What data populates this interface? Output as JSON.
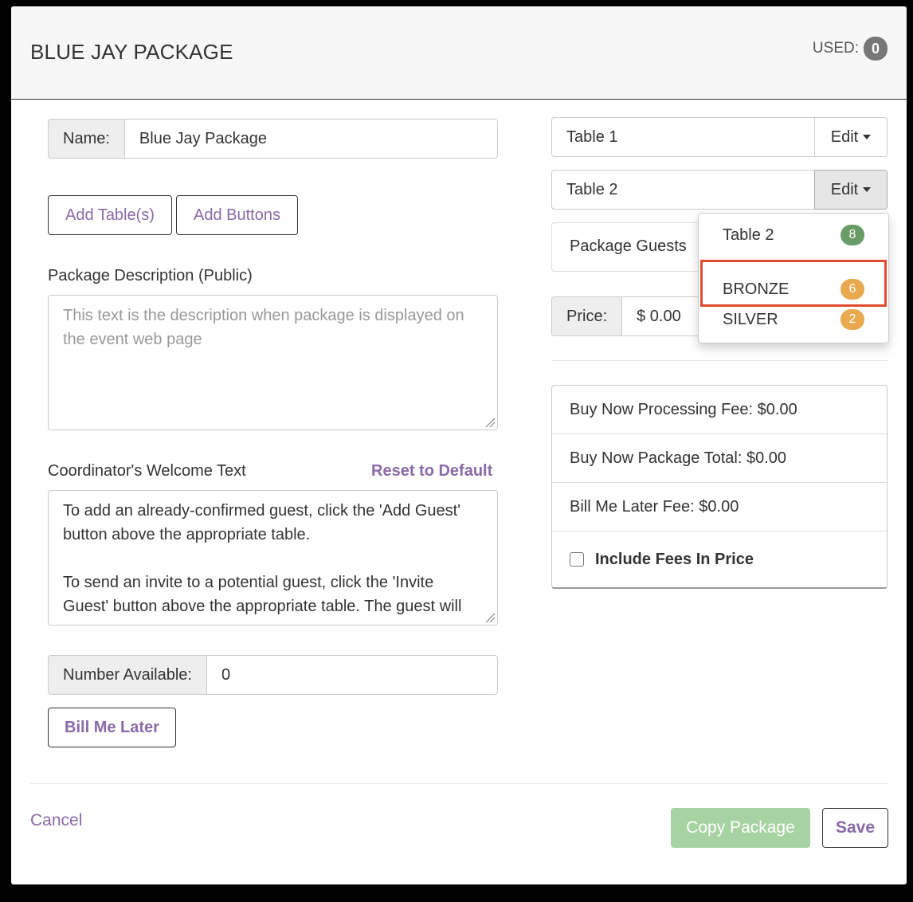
{
  "header": {
    "title": "BLUE JAY PACKAGE",
    "used_label": "USED:",
    "used_count": "0"
  },
  "form": {
    "name_label": "Name:",
    "name_value": "Blue Jay Package",
    "add_tables_label": "Add Table(s)",
    "add_buttons_label": "Add Buttons",
    "description_label": "Package Description (Public)",
    "description_placeholder": "This text is the description when package is displayed on the event web page",
    "welcome_label": "Coordinator's Welcome Text",
    "reset_label": "Reset to Default",
    "welcome_text_p1": "To add an already-confirmed guest, click the 'Add Guest' button above the appropriate table.",
    "welcome_text_p2": "To send an invite to a potential guest, click the 'Invite Guest' button above the appropriate table. The guest will",
    "number_label": "Number Available:",
    "number_value": "0",
    "bill_me_later_label": "Bill Me Later"
  },
  "tables": [
    {
      "name": "Table 1",
      "edit_label": "Edit"
    },
    {
      "name": "Table 2",
      "edit_label": "Edit"
    }
  ],
  "package_guests_label": "Package Guests",
  "price": {
    "label": "Price:",
    "value": "$ 0.00"
  },
  "dropdown": {
    "items": [
      {
        "label": "Table 2",
        "count": "8",
        "color": "#6a9c68"
      },
      {
        "label": "BRONZE",
        "count": "6",
        "color": "#e9a94e"
      },
      {
        "label": "SILVER",
        "count": "2",
        "color": "#e9a94e"
      }
    ]
  },
  "fees": {
    "processing": "Buy Now Processing Fee: $0.00",
    "total": "Buy Now Package Total: $0.00",
    "bill_later": "Bill Me Later Fee: $0.00",
    "include_label": "Include Fees In Price"
  },
  "footer": {
    "cancel_label": "Cancel",
    "copy_label": "Copy Package",
    "save_label": "Save"
  }
}
